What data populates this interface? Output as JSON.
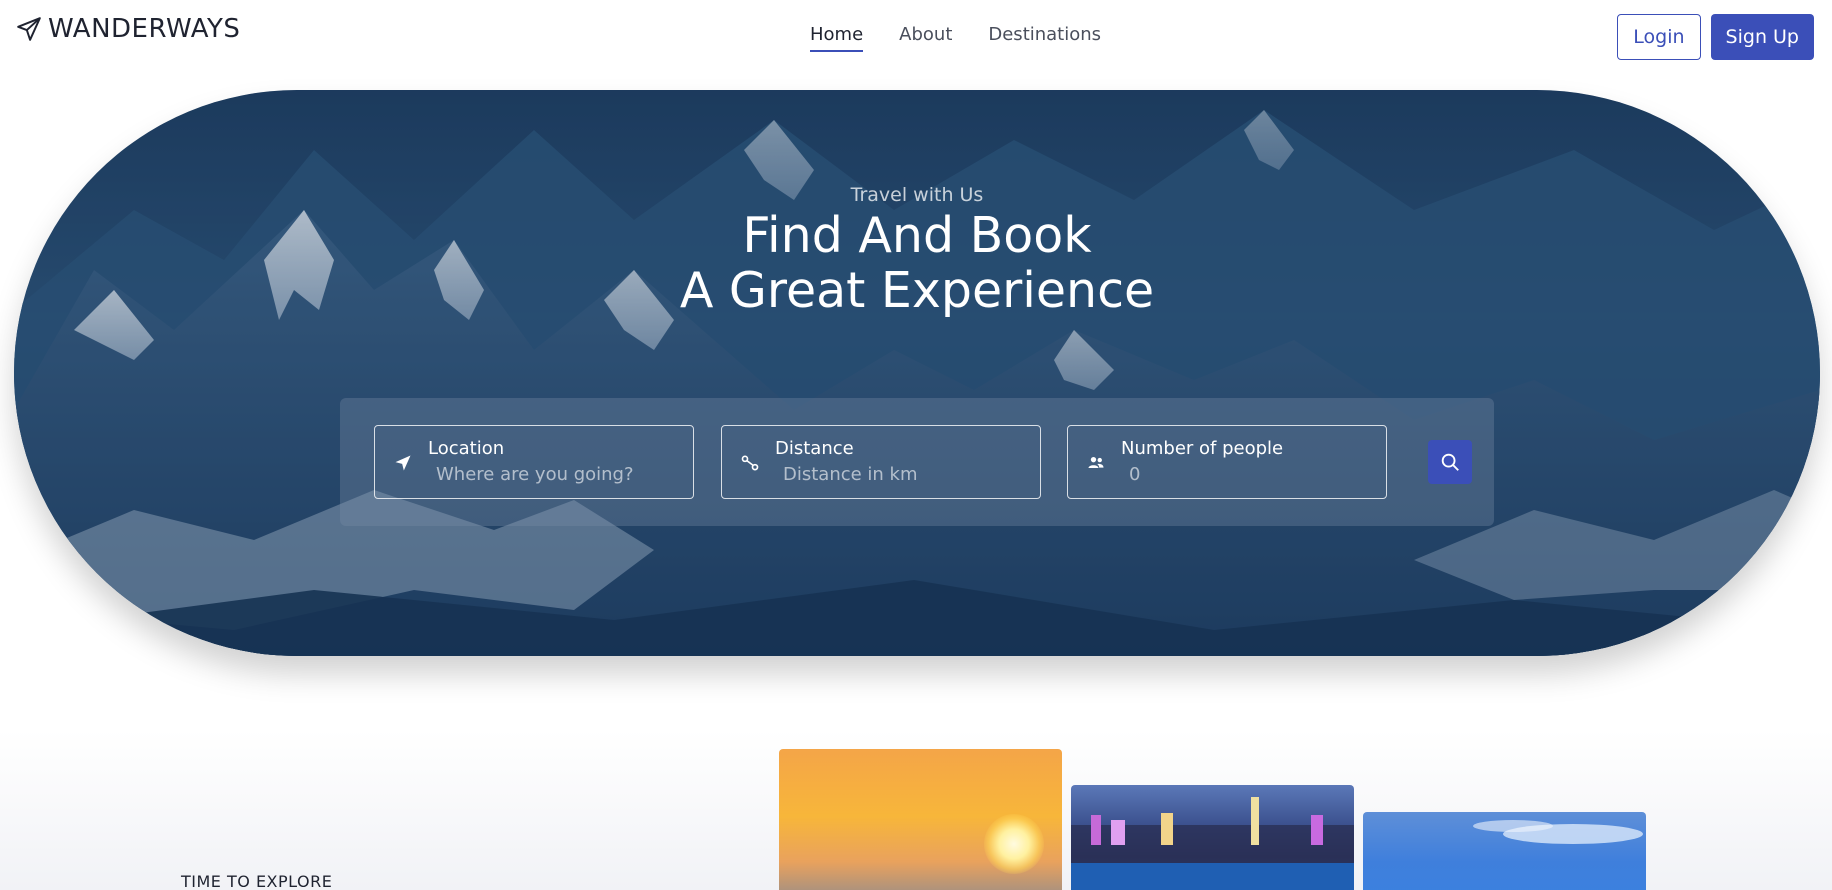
{
  "brand": {
    "name": "WANDERWAYS",
    "icon": "paper-plane-icon"
  },
  "nav": {
    "items": [
      {
        "label": "Home",
        "active": true
      },
      {
        "label": "About",
        "active": false
      },
      {
        "label": "Destinations",
        "active": false
      }
    ]
  },
  "auth": {
    "login_label": "Login",
    "signup_label": "Sign Up"
  },
  "hero": {
    "subtitle": "Travel with Us",
    "title_line1": "Find And Book",
    "title_line2": "A Great Experience"
  },
  "search": {
    "location": {
      "label": "Location",
      "placeholder": "Where are you going?",
      "icon": "navigation-arrow-icon"
    },
    "distance": {
      "label": "Distance",
      "placeholder": "Distance in km",
      "icon": "route-icon"
    },
    "people": {
      "label": "Number of people",
      "placeholder": "0",
      "icon": "users-icon"
    },
    "button_icon": "search-icon"
  },
  "explore": {
    "label": "TIME TO EXPLORE"
  },
  "colors": {
    "accent": "#3b4fb8",
    "text": "#1f2330"
  }
}
